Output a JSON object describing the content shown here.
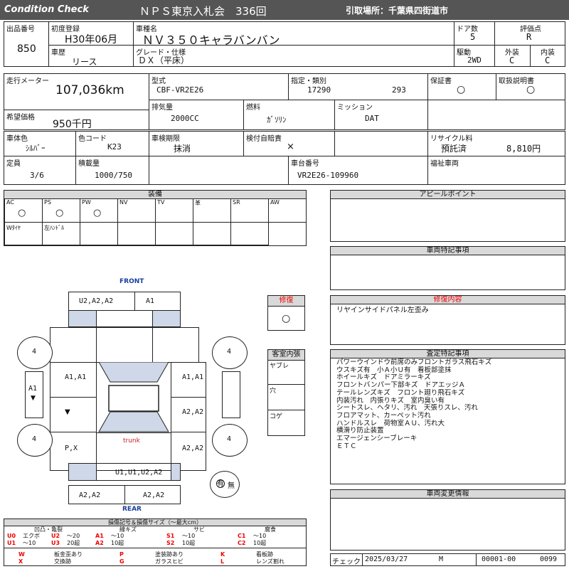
{
  "header": {
    "title_left": "Condition  Check",
    "center": "ＮＰＳ東京入札会　336回",
    "right": "引取場所：千葉県四街道市"
  },
  "top": {
    "lot_label": "出品番号",
    "lot_value": "850",
    "first_reg_label": "初度登録",
    "first_reg_value": "H30年06月",
    "model_label": "車種名",
    "model_value": "ＮＶ３５０キャラバンバン",
    "doors_label": "ドア数",
    "doors_value": "5",
    "score_label": "評価点",
    "score_value": "R",
    "history_label": "車歴",
    "history_value": "リース",
    "grade_label": "グレード・仕様",
    "grade_value": "ＤＸ（平床）",
    "drive_label": "駆動",
    "drive_value": "2WD",
    "ext_label": "外装",
    "ext_value": "C",
    "int_label": "内装",
    "int_value": "C"
  },
  "row2": {
    "mileage_label": "走行メーター",
    "mileage_value": "107,036km",
    "type_label": "型式",
    "type_value": "CBF-VR2E26",
    "designation_label": "指定・類別",
    "designation_value": "17290",
    "class_value": "293",
    "warranty_label": "保証書",
    "warranty_value": "○",
    "manual_label": "取扱説明書",
    "manual_value": "○",
    "price_label": "希望価格",
    "price_value": "950千円",
    "displacement_label": "排気量",
    "displacement_value": "2000CC",
    "fuel_label": "燃料",
    "fuel_value": "ｶﾞｿﾘﾝ",
    "mission_label": "ミッション",
    "mission_value": "DAT",
    "color_label": "車体色",
    "color_value": "ｼﾙﾊﾞｰ",
    "colorcode_label": "色コード",
    "colorcode_value": "K23",
    "inspection_label": "車検期限",
    "inspection_value": "抹消",
    "insurance_label": "検付自賠責",
    "insurance_value": "×",
    "recycle_label": "リサイクル料",
    "recycle_status": "預託済",
    "recycle_value": "8,810円",
    "capacity_label": "定員",
    "capacity_value": "3/6",
    "load_label": "積載量",
    "load_value": "1000/750",
    "chassis_label": "車台番号",
    "chassis_value": "VR2E26-109960",
    "welfare_label": "福祉車両"
  },
  "equipment": {
    "title": "装備",
    "row1": [
      {
        "label": "AC",
        "mark": "○"
      },
      {
        "label": "PS",
        "mark": "○"
      },
      {
        "label": "PW",
        "mark": "○"
      },
      {
        "label": "NV",
        "mark": ""
      },
      {
        "label": "TV",
        "mark": ""
      },
      {
        "label": "革",
        "mark": ""
      },
      {
        "label": "SR",
        "mark": ""
      },
      {
        "label": "AW",
        "mark": ""
      }
    ],
    "row2": [
      {
        "label": "Wﾀｲﾔ"
      },
      {
        "label": "左ﾊﾝﾄﾞﾙ"
      },
      {
        "label": ""
      },
      {
        "label": ""
      },
      {
        "label": ""
      },
      {
        "label": ""
      },
      {
        "label": ""
      }
    ]
  },
  "right_sections": {
    "appeal_title": "アピールポイント",
    "special_title": "車両特記事項",
    "repair_title": "修復内容",
    "repair_text": "リヤインサイドパネル左歪み",
    "inspection_title": "査定特記事項",
    "inspection_lines": [
      "パワーウインドウ前席のみフロントガラス飛石キズ",
      "ウスキズ有　小Ａ小Ｕ有　看板部塗抹",
      "ホイールキズ　ドアミラーキズ",
      "フロントバンパー下部キズ　ドアエッジＡ",
      "テールレンズキズ　フロント廻り飛石キズ",
      "内装汚れ　内張りキズ　室内臭い有",
      "シートスレ、ヘタリ、汚れ　天張りスレ、汚れ",
      "フロアマット、カーペット汚れ",
      "ハンドルスレ　荷物室ＡＵ、汚れ大",
      "横滑り防止装置",
      "エマージェンシーブレーキ",
      "ＥＴＣ"
    ],
    "change_title": "車両変更情報"
  },
  "repair_box": {
    "title": "修復",
    "mark": "○"
  },
  "cabin_box": {
    "title": "客室内張",
    "items": [
      "ヤブレ",
      "穴",
      "コゲ"
    ]
  },
  "diagram": {
    "front": "FRONT",
    "rear": "REAR",
    "trunk": "trunk",
    "front_bumper_left": "U2,A2,A2",
    "front_bumper_right": "A1",
    "fl_door": "A1,A1",
    "fr_door": "A1,A1",
    "rl_door": "▼",
    "rr_door": "A2,A2",
    "left_panel": "P,X",
    "right_panel": "A2,A2",
    "rear_panel": "U1,U1,U2,A2",
    "rear_bumper_left": "A2,A2",
    "rear_bumper_right": "A2,A2",
    "left_side": "A1",
    "left_side_mark": "▼",
    "tire_fl": "4",
    "tire_fr": "4",
    "tire_rl": "4",
    "tire_rr": "4",
    "spare_symbol": "有",
    "spare_none": "無"
  },
  "legend": {
    "title": "損傷記号＆損傷サイズ（～最大cm）",
    "groups": [
      "凹凸・亀裂",
      "線キズ",
      "サビ",
      "腐食"
    ],
    "codes": [
      {
        "c": "U0",
        "d": "エクボ"
      },
      {
        "c": "U2",
        "d": "～20"
      },
      {
        "c": "A1",
        "d": "～10"
      },
      {
        "c": "S1",
        "d": "～10"
      },
      {
        "c": "C1",
        "d": "～10"
      },
      {
        "c": "U1",
        "d": "～10"
      },
      {
        "c": "U3",
        "d": "20超"
      },
      {
        "c": "A2",
        "d": "10超"
      },
      {
        "c": "S2",
        "d": "10超"
      },
      {
        "c": "C2",
        "d": "10超"
      }
    ],
    "marks": [
      {
        "c": "W",
        "d": "板金歪あり"
      },
      {
        "c": "P",
        "d": "塗装跡あり"
      },
      {
        "c": "K",
        "d": "看板跡"
      },
      {
        "c": "X",
        "d": "交換跡"
      },
      {
        "c": "G",
        "d": "ガラスヒビ"
      },
      {
        "c": "L",
        "d": "レンズ割れ"
      }
    ]
  },
  "footer": {
    "check_label": "チェック",
    "date": "2025/03/27",
    "inspector": "M",
    "number": "00001-00",
    "page": "0099"
  }
}
